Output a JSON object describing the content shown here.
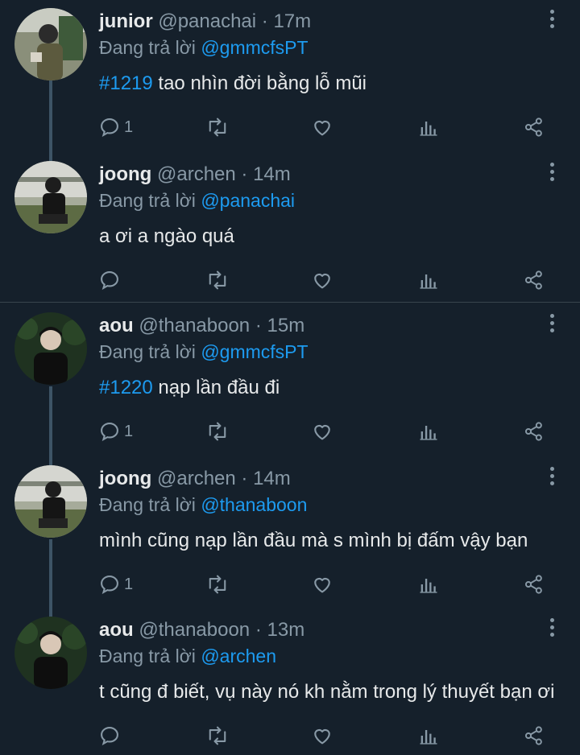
{
  "reply_prefix": "Đang trả lời",
  "tweets": [
    {
      "name": "junior",
      "handle": "@panachai",
      "time": "17m",
      "reply_to": "@gmmcfsPT",
      "hashtag": "#1219",
      "text": " tao nhìn đời bằng lỗ mũi",
      "reply_count": "1"
    },
    {
      "name": "joong",
      "handle": "@archen",
      "time": "14m",
      "reply_to": "@panachai",
      "hashtag": "",
      "text": "a ơi a ngào quá",
      "reply_count": ""
    },
    {
      "name": "aou",
      "handle": "@thanaboon",
      "time": "15m",
      "reply_to": "@gmmcfsPT",
      "hashtag": "#1220",
      "text": " nạp lần đầu đi",
      "reply_count": "1"
    },
    {
      "name": "joong",
      "handle": "@archen",
      "time": "14m",
      "reply_to": "@thanaboon",
      "hashtag": "",
      "text": "mình cũng nạp lần đầu mà s mình bị đấm vậy bạn",
      "reply_count": "1"
    },
    {
      "name": "aou",
      "handle": "@thanaboon",
      "time": "13m",
      "reply_to": "@archen",
      "hashtag": "",
      "text": "t cũng đ biết, vụ này nó kh nằm trong lý thuyết bạn ơi",
      "reply_count": ""
    }
  ],
  "icons": {
    "reply": "reply-icon",
    "retweet": "retweet-icon",
    "like": "like-icon",
    "views": "views-icon",
    "share": "share-icon",
    "more": "more-options-icon"
  },
  "colors": {
    "background": "#15202b",
    "link": "#1d9bf0",
    "muted": "#8899a6"
  }
}
